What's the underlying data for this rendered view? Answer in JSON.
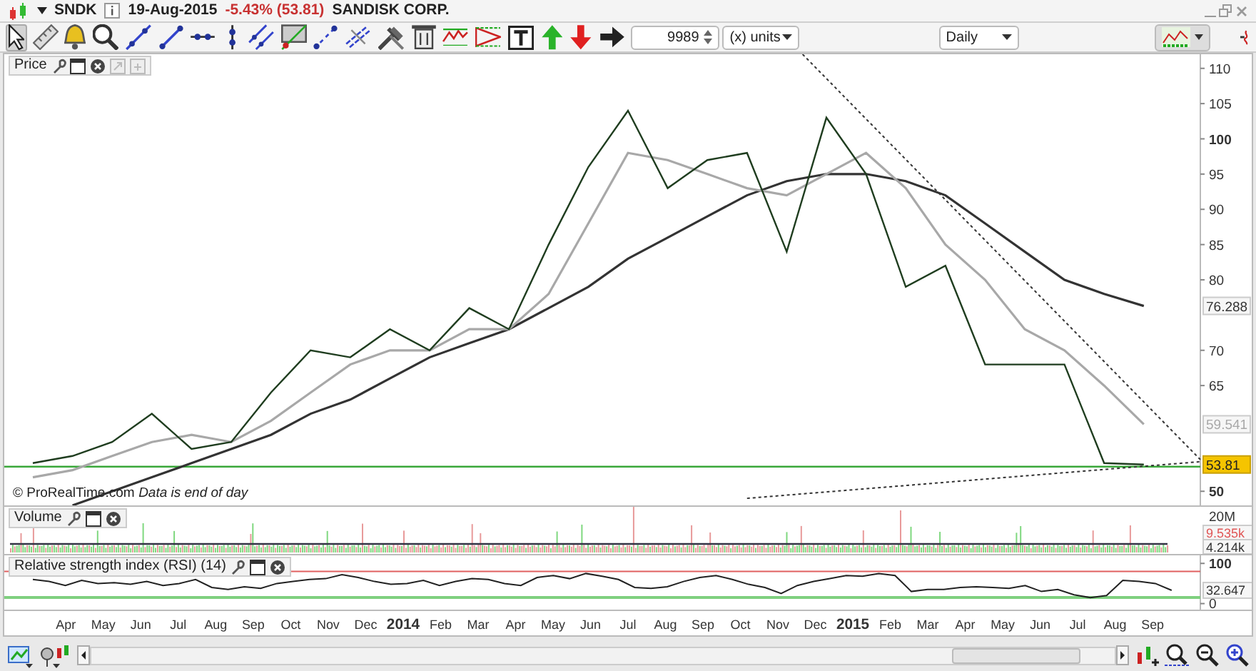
{
  "header": {
    "symbol": "SNDK",
    "date": "19-Aug-2015",
    "change": "-5.43% (53.81)",
    "name": "SANDISK CORP."
  },
  "tools": [
    {
      "selected": true
    },
    {
      "selected": false
    },
    {
      "selected": false
    },
    {
      "selected": false
    },
    {
      "selected": false
    },
    {
      "selected": false
    },
    {
      "selected": false
    },
    {
      "selected": false
    },
    {
      "selected": false
    },
    {
      "selected": false
    },
    {
      "selected": false
    },
    {
      "selected": false
    },
    {
      "selected": false
    },
    {
      "selected": false
    },
    {
      "selected": false
    },
    {
      "selected": false
    },
    {
      "selected": false
    },
    {
      "selected": false
    },
    {
      "selected": false
    },
    {
      "selected": false
    }
  ],
  "units": {
    "value": "9989",
    "label": "(x) units"
  },
  "period": "Daily",
  "price_panel": {
    "label": "Price",
    "copyright": "© ProRealTime.com",
    "note": "Data is end of day",
    "last_values": [
      {
        "text": "76.288",
        "kind": "outlined",
        "color": "#333333"
      },
      {
        "text": "59.541",
        "kind": "outlined",
        "color": "#a8a8a8"
      },
      {
        "text": "53.81",
        "kind": "filled",
        "color": "#f5c400"
      }
    ],
    "chart_data": {
      "type": "line",
      "series": [
        {
          "color": "#333333",
          "values": [
            null,
            48,
            50,
            52,
            54,
            56,
            58,
            61,
            63,
            66,
            69,
            71,
            73,
            76,
            79,
            83,
            86,
            89,
            92,
            94,
            95,
            95,
            94,
            92,
            88,
            84,
            80,
            78,
            76.3,
            null
          ]
        },
        {
          "color": "#a8a8a8",
          "values": [
            52,
            53,
            55,
            57,
            58,
            57,
            60,
            64,
            68,
            70,
            70,
            73,
            73,
            78,
            88,
            98,
            97,
            95,
            93,
            92,
            95,
            98,
            93,
            85,
            80,
            73,
            70,
            65,
            59.5,
            null
          ]
        },
        {
          "color": "#1f3d1f",
          "values": [
            54,
            55,
            57,
            61,
            56,
            57,
            64,
            70,
            69,
            73,
            70,
            76,
            73,
            85,
            96,
            104,
            93,
            97,
            98,
            84,
            103,
            95,
            79,
            82,
            68,
            68,
            68,
            54,
            53.8,
            null
          ]
        }
      ],
      "ylim": [
        48,
        112
      ],
      "yticks": [
        {
          "value": 50,
          "label": "50"
        },
        {
          "value": 65,
          "label": "65"
        },
        {
          "value": 70,
          "label": "70"
        },
        {
          "value": 80,
          "label": "80"
        },
        {
          "value": 85,
          "label": "85"
        },
        {
          "value": 90,
          "label": "90"
        },
        {
          "value": 95,
          "label": "95"
        },
        {
          "value": 100,
          "label": "100"
        },
        {
          "value": 105,
          "label": "105"
        },
        {
          "value": 110,
          "label": "110"
        }
      ],
      "ref_lines": [
        {
          "axis": "y",
          "value": 53.5
        }
      ]
    }
  },
  "volume_panel": {
    "label": "Volume",
    "ticks": [
      "20M"
    ],
    "readings": [
      {
        "text": "9.535k",
        "color": "#e05555"
      },
      {
        "text": "4.214k",
        "color": "#333333"
      }
    ]
  },
  "rsi_panel": {
    "label": "Relative strength index (RSI) (14)",
    "readings": [
      {
        "text": "32.647",
        "color": "#333333"
      }
    ],
    "chart_data": {
      "type": "line",
      "series": [
        {
          "color": "#222222",
          "values": [
            60,
            55,
            45,
            58,
            50,
            52,
            48,
            55,
            45,
            50,
            60,
            40,
            35,
            42,
            38,
            50,
            55,
            60,
            62,
            72,
            65,
            55,
            48,
            50,
            58,
            45,
            55,
            62,
            60,
            50,
            45,
            65,
            70,
            62,
            75,
            68,
            60,
            40,
            38,
            42,
            55,
            65,
            70,
            60,
            48,
            40,
            25,
            45,
            55,
            62,
            70,
            68,
            75,
            70,
            30,
            35,
            35,
            40,
            42,
            40,
            38,
            45,
            30,
            35,
            22,
            15,
            20,
            58,
            55,
            50,
            33
          ]
        }
      ],
      "ylim": [
        -15,
        120
      ],
      "yticks": [
        {
          "value": 0,
          "label": "0"
        },
        {
          "value": 100,
          "label": "100"
        }
      ],
      "ref_lines": [
        {
          "axis": "y",
          "value": 80
        },
        {
          "axis": "y",
          "value": 15
        }
      ]
    }
  },
  "time_axis": [
    "Apr",
    "May",
    "Jun",
    "Jul",
    "Aug",
    "Sep",
    "Oct",
    "Nov",
    "Dec",
    "2014",
    "Feb",
    "Mar",
    "Apr",
    "May",
    "Jun",
    "Jul",
    "Aug",
    "Sep",
    "Oct",
    "Nov",
    "Dec",
    "2015",
    "Feb",
    "Mar",
    "Apr",
    "May",
    "Jun",
    "Jul",
    "Aug",
    "Sep"
  ]
}
